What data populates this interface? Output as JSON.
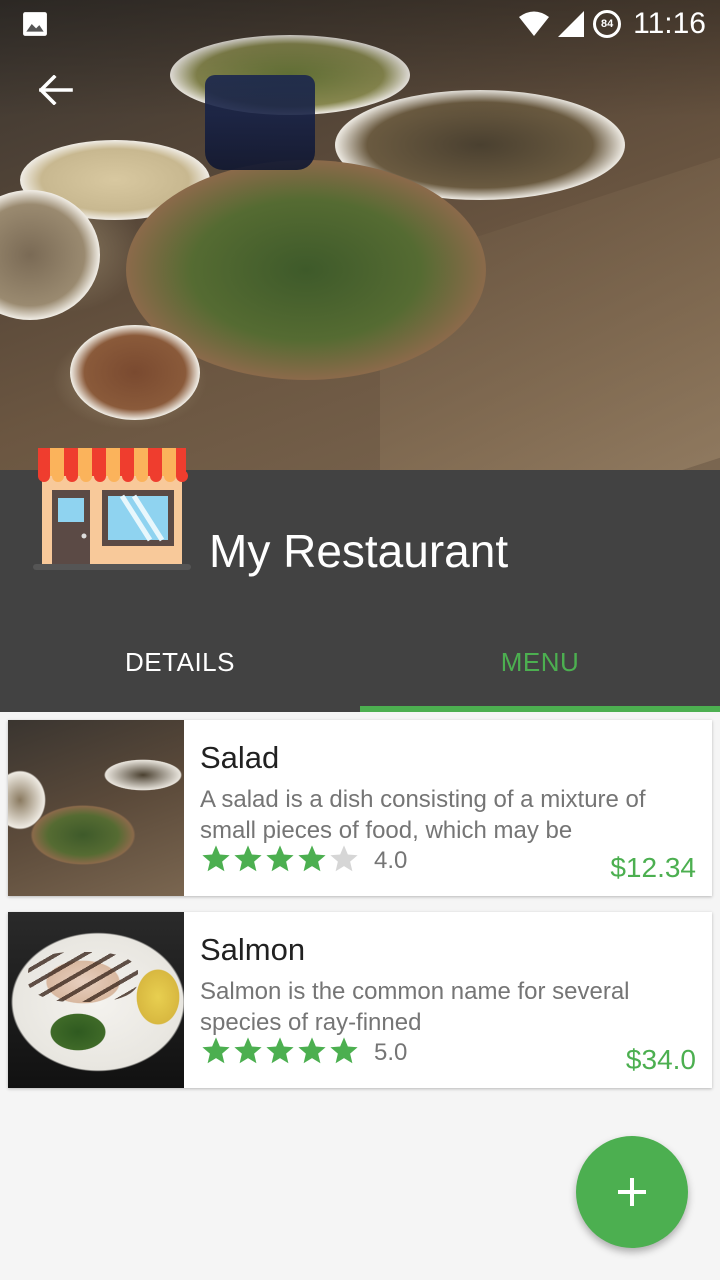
{
  "status_bar": {
    "time": "11:16",
    "battery": "84"
  },
  "header": {
    "title": "My Restaurant"
  },
  "tabs": [
    {
      "label": "DETAILS",
      "selected": false
    },
    {
      "label": "MENU",
      "selected": true
    }
  ],
  "menu_items": [
    {
      "name": "Salad",
      "description": "A salad is a dish consisting of a mixture of small pieces of food, which may be",
      "rating": 4.0,
      "rating_text": "4.0",
      "price": "$12.34"
    },
    {
      "name": "Salmon",
      "description": "Salmon is the common name for several species of ray-finned",
      "rating": 5.0,
      "rating_text": "5.0",
      "price": "$34.0"
    }
  ],
  "colors": {
    "accent": "#4caf50",
    "header": "#424242",
    "star_empty": "#d6d6d6"
  },
  "icons": [
    "image-icon",
    "wifi-icon",
    "signal-icon",
    "battery-saver-icon",
    "back-arrow-icon",
    "store-icon",
    "star-icon",
    "add-icon"
  ]
}
